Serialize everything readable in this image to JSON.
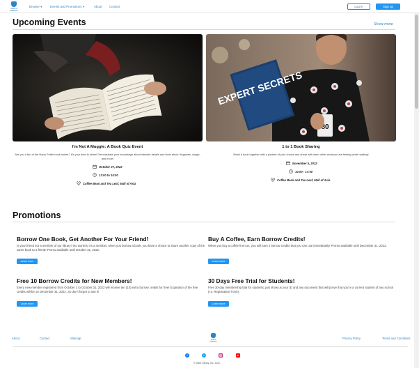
{
  "nav": {
    "logo_text": "SHELF LIBRARY",
    "browse": "Browse",
    "events_promotions": "Events and Promotions",
    "about": "About",
    "contact": "Contact",
    "login": "Log In",
    "signup": "Sign up",
    "caret": "▼"
  },
  "events": {
    "section_title": "Upcoming Events",
    "show_more": "Show more",
    "items": [
      {
        "title": "I'm Not A Muggle: A Book Quiz Event",
        "description": "Are you a fan of the Harry Potter book series? It's your time to shine! Demonstrate your knowledge about intricate details and facts about Hogwarts, magic, and more!",
        "date": "October 27, 2022",
        "time": "13:00 to 15:00",
        "location": "Coffee Bean and Tea Leaf, Mall of Asia"
      },
      {
        "title": "1 to 1 Book Sharing",
        "description": "Read a book together with a partner of your choice and share with each other what you are feeling while reading!",
        "date": "November 5, 2022",
        "time": "10:00 - 17:00",
        "location": "Coffee Bean and Tea Leaf, Mall of Asia",
        "book_cover_text": "EXPERT SECRETS",
        "mug_text": "80"
      }
    ]
  },
  "promotions": {
    "section_title": "Promotions",
    "items": [
      {
        "title": "Borrow One Book, Get Another For Your Friend!",
        "description": "Is your friend not a member of our library? No worries! As a member, when you borrow a book, you have a choice to share another copy of the same book to a friend! Promo available until October 31, 2022.",
        "button": "Learn more"
      },
      {
        "title": "Buy A Coffee, Earn Borrow Credits!",
        "description": "When you buy a coffee from us, you will earn 2 borrow credits that you can use immediately! Promo available until December 31, 2022.",
        "button": "Learn more"
      },
      {
        "title": "Free 10 Borrow Credits for New Members!",
        "description": "Every new member registered from October 1 to October 31, 2022 will receive ten (10) extra borrow credits for free! Expiration of the free credits will be on December 31, 2022. So don't forget to use it!",
        "button": "Learn more"
      },
      {
        "title": "30 Days Free Trial for Students!",
        "description": "Free 30-day membership trial for students, just show us your ID and any document that will prove that you're a current student of any school (i.e. Registration Form).",
        "button": "Learn more"
      }
    ]
  },
  "footer": {
    "about": "About",
    "contact": "Contact",
    "sitemap": "Sitemap",
    "privacy": "Privacy Policy",
    "terms": "Terms and Conditions",
    "logo_text": "SHELF LIBRARY",
    "copyright": "© Shelf Library, Inc. 2022"
  },
  "colors": {
    "accent": "#2196f3",
    "link": "#2b86c8",
    "facebook": "#1877f2",
    "twitter": "#1da1f2",
    "instagram": "#c13584",
    "youtube": "#ff0000"
  },
  "icons": {
    "date": "calendar-icon",
    "time": "clock-icon",
    "location": "map-pin-icon",
    "social": [
      "facebook-icon",
      "twitter-icon",
      "instagram-icon",
      "youtube-icon"
    ]
  }
}
